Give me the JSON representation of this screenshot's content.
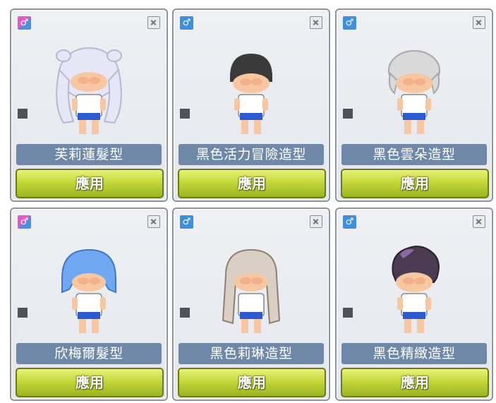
{
  "apply_label": "應用",
  "gender_symbol": "♂",
  "colors": {
    "name_bar": "#6f88a8",
    "apply_top": "#e9f27a",
    "apply_bottom": "#9bb421"
  },
  "items": [
    {
      "name": "芙莉蓮髮型",
      "gender": "unisex",
      "hair_color": "#e6e6f6",
      "hair_style": "twintail"
    },
    {
      "name": "黑色活力冒險造型",
      "gender": "male",
      "hair_color": "#3a3a3a",
      "hair_style": "buzz"
    },
    {
      "name": "黑色雲朵造型",
      "gender": "male",
      "hair_color": "#d9d9d9",
      "hair_style": "fluffy"
    },
    {
      "name": "欣梅爾髮型",
      "gender": "unisex",
      "hair_color": "#6fa8f0",
      "hair_style": "bob"
    },
    {
      "name": "黑色莉琳造型",
      "gender": "male",
      "hair_color": "#d9cfc4",
      "hair_style": "long"
    },
    {
      "name": "黑色精緻造型",
      "gender": "male",
      "hair_color": "#4a3a52",
      "hair_style": "pompadour"
    }
  ]
}
